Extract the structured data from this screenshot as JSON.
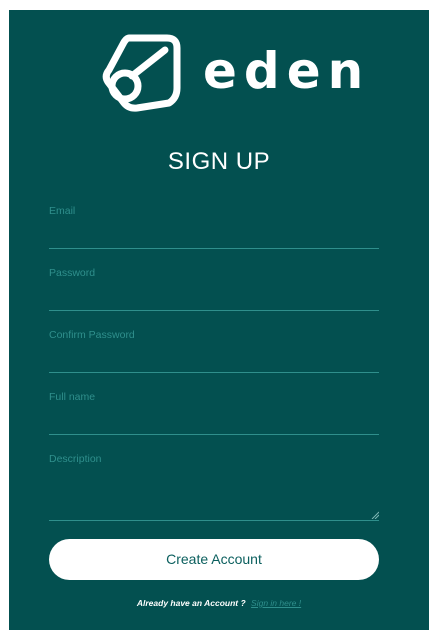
{
  "brand": {
    "logo_icon": "eden-triangle-logo-icon",
    "name": "eden"
  },
  "form": {
    "title": "SIGN UP",
    "fields": [
      {
        "label": "Email",
        "value": ""
      },
      {
        "label": "Password",
        "value": ""
      },
      {
        "label": "Confirm Password",
        "value": ""
      },
      {
        "label": "Full name",
        "value": ""
      },
      {
        "label": "Description",
        "value": ""
      }
    ],
    "submit_label": "Create Account"
  },
  "footer": {
    "prompt": "Already have an Account ?",
    "link_label": "Sign in here !"
  },
  "colors": {
    "panel_background": "#035050",
    "accent": "#2f8f8c",
    "button_background": "#ffffff",
    "button_text": "#0b5f5e"
  }
}
